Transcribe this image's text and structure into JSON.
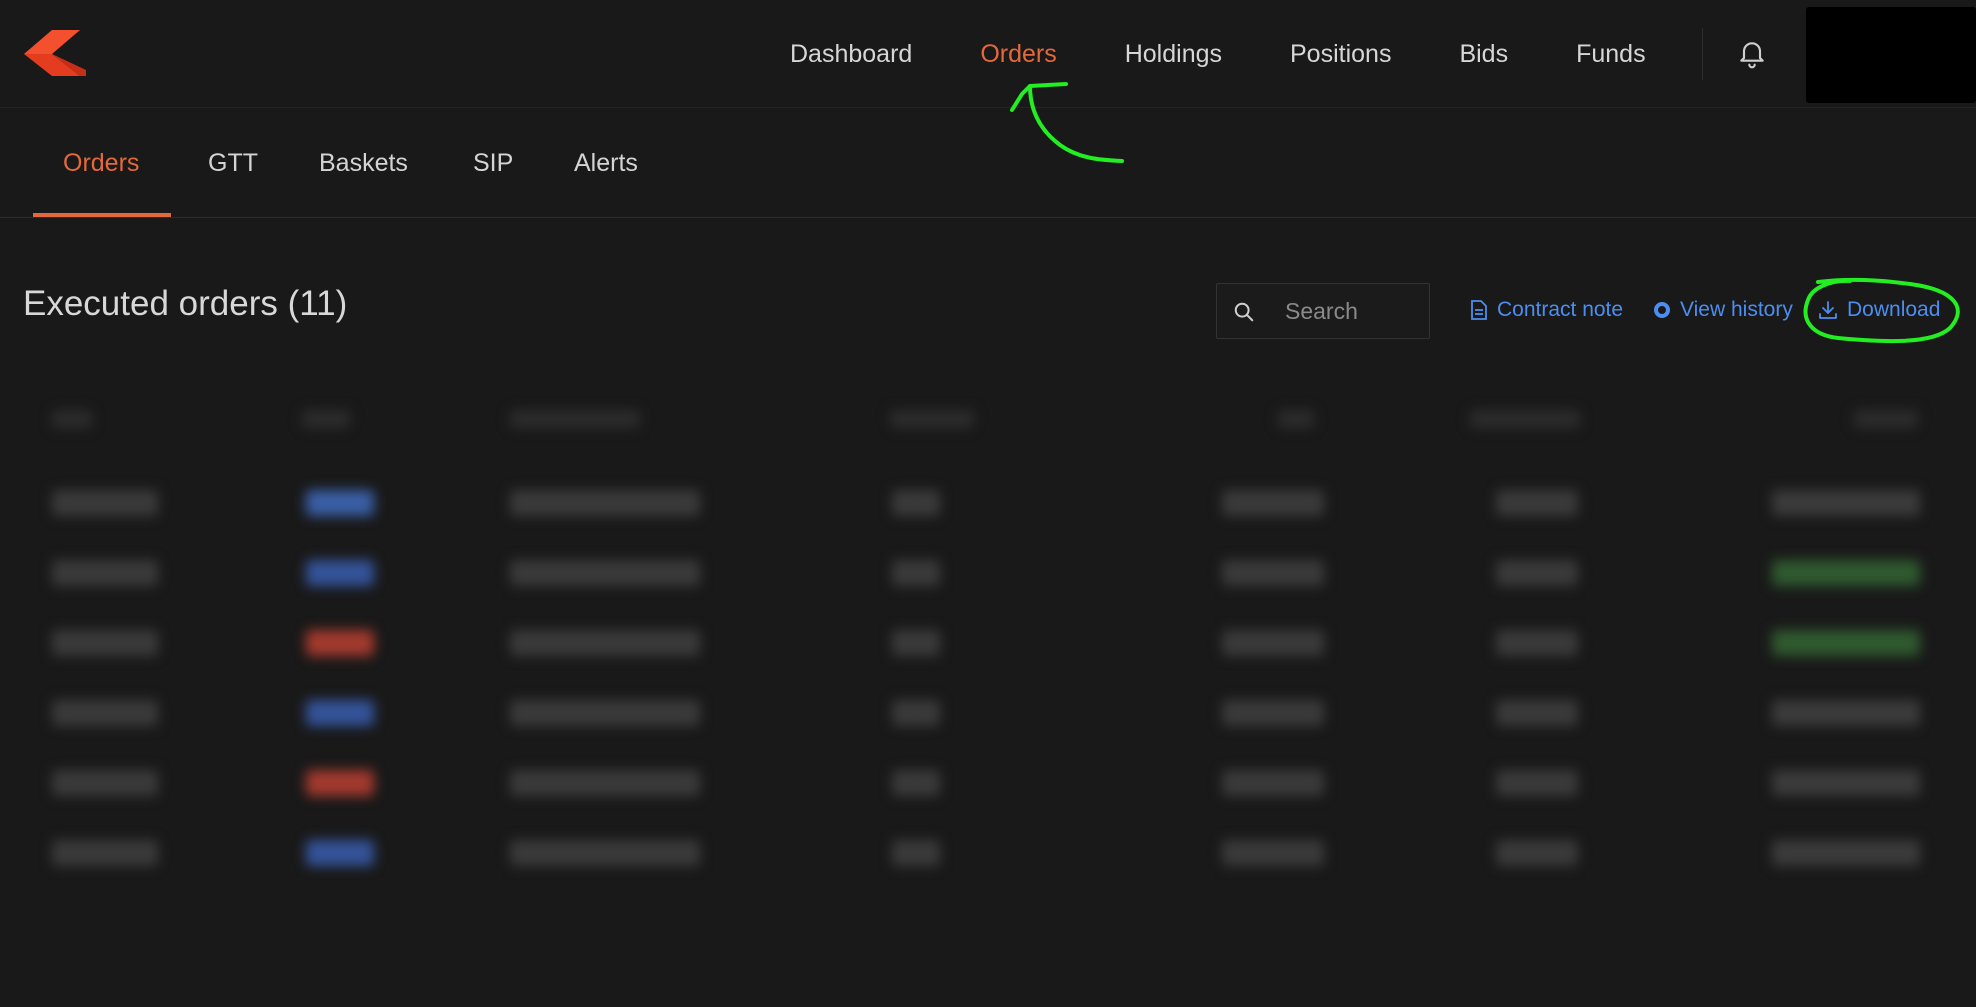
{
  "nav": {
    "items": [
      "Dashboard",
      "Orders",
      "Holdings",
      "Positions",
      "Bids",
      "Funds"
    ],
    "active": "Orders"
  },
  "subtabs": {
    "items": [
      "Orders",
      "GTT",
      "Baskets",
      "SIP",
      "Alerts"
    ],
    "active": "Orders"
  },
  "executed": {
    "title": "Executed orders (11)"
  },
  "search": {
    "placeholder": "Search"
  },
  "actions": {
    "contract_note": "Contract note",
    "view_history": "View history",
    "download": "Download"
  },
  "colors": {
    "accent": "#e4683a",
    "link": "#4c8ef0",
    "background": "#191919",
    "annotation": "#22ee22"
  }
}
